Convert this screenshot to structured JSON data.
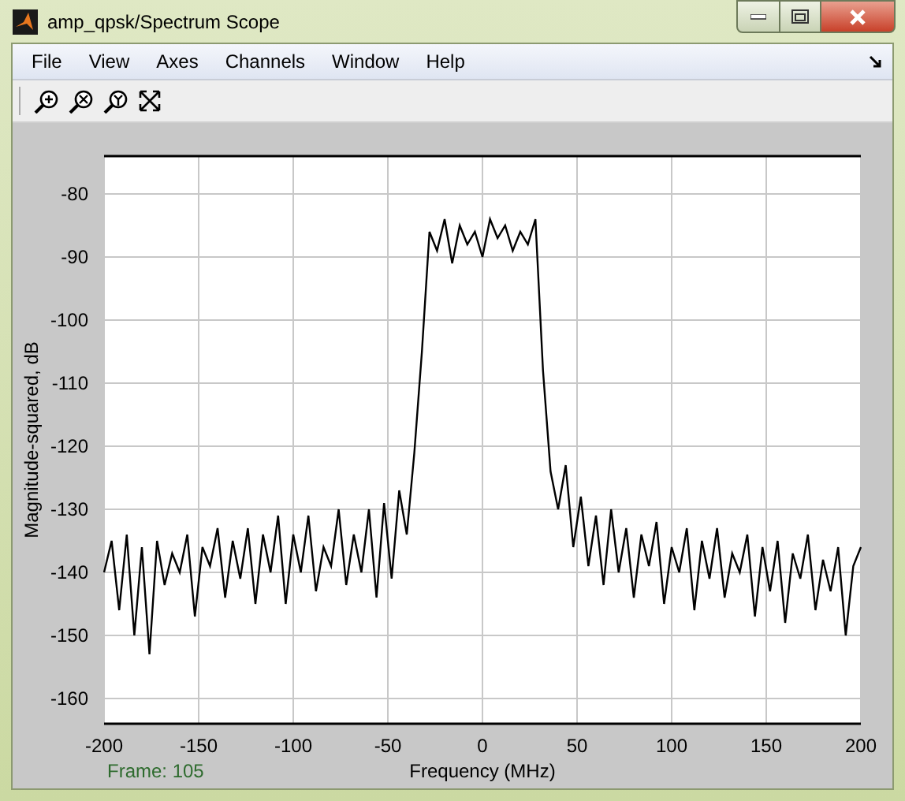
{
  "window": {
    "title": "amp_qpsk/Spectrum Scope"
  },
  "menu": [
    "File",
    "View",
    "Axes",
    "Channels",
    "Window",
    "Help"
  ],
  "toolbar": [
    {
      "kind": "zoom-in"
    },
    {
      "kind": "zoom-x"
    },
    {
      "kind": "zoom-y"
    },
    {
      "kind": "autoscale"
    }
  ],
  "plot": {
    "frame_label": "Frame: 105",
    "chart_data": {
      "type": "line",
      "grid": true,
      "xlabel": "Frequency (MHz)",
      "ylabel": "Magnitude-squared, dB",
      "xlim": [
        -200,
        200
      ],
      "ylim": [
        -164,
        -74
      ],
      "xticks": [
        -200,
        -150,
        -100,
        -50,
        0,
        50,
        100,
        150,
        200
      ],
      "yticks": [
        -160,
        -150,
        -140,
        -130,
        -120,
        -110,
        -100,
        -90,
        -80
      ],
      "x": [
        -200,
        -196,
        -192,
        -188,
        -184,
        -180,
        -176,
        -172,
        -168,
        -164,
        -160,
        -156,
        -152,
        -148,
        -144,
        -140,
        -136,
        -132,
        -128,
        -124,
        -120,
        -116,
        -112,
        -108,
        -104,
        -100,
        -96,
        -92,
        -88,
        -84,
        -80,
        -76,
        -72,
        -68,
        -64,
        -60,
        -56,
        -52,
        -48,
        -44,
        -40,
        -36,
        -32,
        -28,
        -24,
        -20,
        -16,
        -12,
        -8,
        -4,
        0,
        4,
        8,
        12,
        16,
        20,
        24,
        28,
        32,
        36,
        40,
        44,
        48,
        52,
        56,
        60,
        64,
        68,
        72,
        76,
        80,
        84,
        88,
        92,
        96,
        100,
        104,
        108,
        112,
        116,
        120,
        124,
        128,
        132,
        136,
        140,
        144,
        148,
        152,
        156,
        160,
        164,
        168,
        172,
        176,
        180,
        184,
        188,
        192,
        196,
        200
      ],
      "series": [
        {
          "color": "#000000",
          "values": [
            -140,
            -135,
            -146,
            -134,
            -150,
            -136,
            -153,
            -135,
            -142,
            -137,
            -140,
            -134,
            -147,
            -136,
            -139,
            -133,
            -144,
            -135,
            -141,
            -133,
            -145,
            -134,
            -140,
            -131,
            -145,
            -134,
            -140,
            -131,
            -143,
            -136,
            -139,
            -130,
            -142,
            -134,
            -140,
            -130,
            -144,
            -129,
            -141,
            -127,
            -134,
            -121,
            -105,
            -86,
            -89,
            -84,
            -91,
            -85,
            -88,
            -86,
            -90,
            -84,
            -87,
            -85,
            -89,
            -86,
            -88,
            -84,
            -108,
            -124,
            -130,
            -123,
            -136,
            -128,
            -139,
            -131,
            -142,
            -130,
            -140,
            -133,
            -144,
            -134,
            -139,
            -132,
            -145,
            -136,
            -140,
            -133,
            -146,
            -135,
            -141,
            -133,
            -144,
            -137,
            -140,
            -134,
            -147,
            -136,
            -143,
            -135,
            -148,
            -137,
            -141,
            -134,
            -146,
            -138,
            -143,
            -136,
            -150,
            -139,
            -136
          ]
        }
      ]
    }
  }
}
